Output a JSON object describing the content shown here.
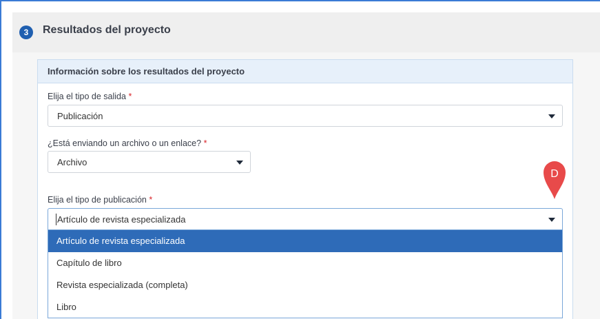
{
  "section": {
    "step_number": "3",
    "title": "Resultados del proyecto"
  },
  "card": {
    "title": "Información sobre los resultados del proyecto"
  },
  "fields": {
    "output_type": {
      "label": "Elija el tipo de salida",
      "required_mark": "*",
      "value": "Publicación"
    },
    "file_or_link": {
      "label": "¿Está enviando un archivo o un enlace?",
      "required_mark": "*",
      "value": "Archivo"
    },
    "publication_type": {
      "label": "Elija el tipo de publicación",
      "required_mark": "*",
      "value": "Artículo de revista especializada",
      "options": [
        "Artículo de revista especializada",
        "Capítulo de libro",
        "Revista especializada (completa)",
        "Libro"
      ],
      "highlighted_option": "Artículo de revista especializada"
    }
  },
  "callout": {
    "letter": "D",
    "color": "#e84a4a"
  },
  "colors": {
    "accent": "#2e6bb8",
    "badge": "#1f5fb0",
    "required": "#d9252a",
    "card_header": "#e7f0fa"
  }
}
